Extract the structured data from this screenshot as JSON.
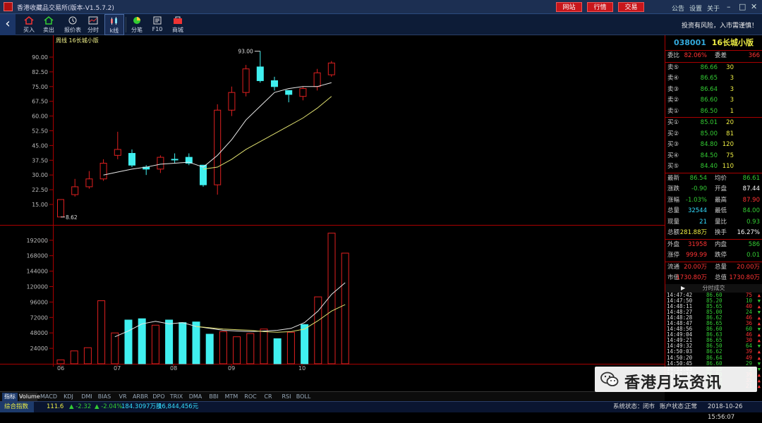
{
  "titlebar": {
    "title": "香港收藏品交易所(版本-V1.5.7.2)",
    "buttons": [
      "网站",
      "行情",
      "交易"
    ],
    "links": [
      "公告",
      "设置",
      "关于"
    ]
  },
  "toolbar": {
    "items": [
      {
        "label": "买入",
        "icon": "buy-icon"
      },
      {
        "label": "卖出",
        "icon": "sell-icon"
      },
      {
        "label": "报价表",
        "icon": "quote-table-icon"
      },
      {
        "label": "分时",
        "icon": "timeshare-icon"
      },
      {
        "label": "k线",
        "icon": "kline-icon"
      },
      {
        "label": "分笔",
        "icon": "tick-icon"
      },
      {
        "label": "F10",
        "icon": "f10-icon"
      },
      {
        "label": "商城",
        "icon": "mall-icon"
      }
    ],
    "risk": "投资有风险，入市需谨慎！"
  },
  "chart_data": {
    "type": "candlestick",
    "title": "周线  16长城小版",
    "yticks": [
      "90.00",
      "82.50",
      "75.00",
      "67.50",
      "60.00",
      "52.50",
      "45.00",
      "37.50",
      "30.00",
      "22.50",
      "15.00"
    ],
    "ylim": [
      8.62,
      93.0
    ],
    "annotations": {
      "high": "93.00",
      "low": "8.62"
    },
    "xticks": [
      "06",
      "07",
      "08",
      "09",
      "10"
    ],
    "candles": [
      {
        "o": 8.62,
        "c": 17.5,
        "h": 17.5,
        "l": 8.62,
        "up": true
      },
      {
        "o": 20,
        "c": 24,
        "h": 28,
        "l": 19,
        "up": true
      },
      {
        "o": 24,
        "c": 28,
        "h": 32,
        "l": 23,
        "up": true
      },
      {
        "o": 28,
        "c": 36,
        "h": 38,
        "l": 27,
        "up": true
      },
      {
        "o": 40,
        "c": 43,
        "h": 52,
        "l": 38,
        "up": true
      },
      {
        "o": 41,
        "c": 35,
        "h": 43,
        "l": 34,
        "up": false
      },
      {
        "o": 34,
        "c": 33,
        "h": 35,
        "l": 30,
        "up": false
      },
      {
        "o": 33,
        "c": 39,
        "h": 40,
        "l": 31,
        "up": true
      },
      {
        "o": 38,
        "c": 38,
        "h": 41,
        "l": 36,
        "up": false
      },
      {
        "o": 39,
        "c": 36,
        "h": 41,
        "l": 35,
        "up": false
      },
      {
        "o": 35,
        "c": 25,
        "h": 35,
        "l": 24,
        "up": false
      },
      {
        "o": 25,
        "c": 63,
        "h": 66,
        "l": 20,
        "up": true
      },
      {
        "o": 63,
        "c": 72,
        "h": 75,
        "l": 60,
        "up": true
      },
      {
        "o": 72,
        "c": 84,
        "h": 86,
        "l": 70,
        "up": true
      },
      {
        "o": 85,
        "c": 78,
        "h": 93,
        "l": 77,
        "up": false
      },
      {
        "o": 78,
        "c": 75,
        "h": 80,
        "l": 73,
        "up": false
      },
      {
        "o": 73,
        "c": 71,
        "h": 73,
        "l": 67,
        "up": false
      },
      {
        "o": 70,
        "c": 74,
        "h": 75,
        "l": 68,
        "up": true
      },
      {
        "o": 75,
        "c": 82,
        "h": 84,
        "l": 73,
        "up": true
      },
      {
        "o": 81,
        "c": 87,
        "h": 88,
        "l": 80,
        "up": true
      }
    ],
    "ma_short": [
      null,
      null,
      null,
      30,
      31.5,
      33,
      34,
      35.5,
      36,
      36.5,
      34,
      40,
      48,
      58,
      65,
      72,
      74,
      75,
      75,
      77
    ],
    "ma_long": [
      null,
      null,
      null,
      null,
      null,
      null,
      null,
      null,
      null,
      null,
      33,
      34,
      38,
      43,
      47,
      51,
      55,
      59,
      64,
      70
    ],
    "volume": {
      "yticks": [
        "192000",
        "168000",
        "144000",
        "120000",
        "96000",
        "72000",
        "48000",
        "24000"
      ],
      "values": [
        6000,
        20000,
        25000,
        98000,
        48000,
        68000,
        70000,
        60000,
        68000,
        64000,
        65000,
        46000,
        50000,
        42000,
        47000,
        54000,
        39000,
        49000,
        61000,
        104000,
        203000,
        172000
      ],
      "up": [
        true,
        true,
        true,
        true,
        true,
        false,
        false,
        true,
        false,
        false,
        false,
        false,
        true,
        true,
        true,
        true,
        false,
        true,
        false,
        true,
        true,
        true
      ],
      "ma1": [
        null,
        null,
        null,
        null,
        42000,
        51000,
        62000,
        66000,
        62000,
        64000,
        58000,
        55000,
        52000,
        51000,
        50000,
        51000,
        52000,
        55000,
        64000,
        82000,
        108000,
        126000
      ],
      "ma2": [
        null,
        null,
        null,
        null,
        null,
        null,
        null,
        null,
        null,
        null,
        58000,
        56000,
        54000,
        53000,
        52000,
        50000,
        49000,
        50000,
        54000,
        67000,
        82000,
        92000
      ]
    }
  },
  "stock": {
    "code": "038001",
    "name": "16长城小版"
  },
  "stats1": [
    {
      "l": "委比",
      "v": "82.06%",
      "vc": "red",
      "l2": "委差",
      "v2": "366",
      "v2c": "red"
    }
  ],
  "sells": [
    {
      "l": "卖⑤",
      "p": "86.66",
      "q": "30"
    },
    {
      "l": "卖④",
      "p": "86.65",
      "q": "3"
    },
    {
      "l": "卖③",
      "p": "86.64",
      "q": "3"
    },
    {
      "l": "卖②",
      "p": "86.60",
      "q": "3"
    },
    {
      "l": "卖①",
      "p": "86.50",
      "q": "1"
    }
  ],
  "buys": [
    {
      "l": "买①",
      "p": "85.01",
      "q": "20"
    },
    {
      "l": "买②",
      "p": "85.00",
      "q": "81"
    },
    {
      "l": "买③",
      "p": "84.80",
      "q": "120"
    },
    {
      "l": "买④",
      "p": "84.50",
      "q": "75"
    },
    {
      "l": "买⑤",
      "p": "84.40",
      "q": "110"
    }
  ],
  "stats2": [
    {
      "l": "最新",
      "v": "86.54",
      "vc": "green",
      "l2": "均价",
      "v2": "86.61",
      "v2c": "green"
    },
    {
      "l": "涨跌",
      "v": "-0.90",
      "vc": "green",
      "l2": "开盘",
      "v2": "87.44",
      "v2c": "white"
    },
    {
      "l": "涨幅",
      "v": "-1.03%",
      "vc": "green",
      "l2": "最高",
      "v2": "87.90",
      "v2c": "red"
    },
    {
      "l": "总量",
      "v": "32544",
      "vc": "cyan",
      "l2": "最低",
      "v2": "84.00",
      "v2c": "green"
    },
    {
      "l": "现量",
      "v": "21",
      "vc": "cyan",
      "l2": "量比",
      "v2": "0.93",
      "v2c": "green"
    },
    {
      "l": "总额",
      "v": "281.88万",
      "vc": "yel",
      "l2": "换手",
      "v2": "16.27%",
      "v2c": "white"
    }
  ],
  "stats3": [
    {
      "l": "外盘",
      "v": "31958",
      "vc": "red",
      "l2": "内盘",
      "v2": "586",
      "v2c": "green"
    },
    {
      "l": "涨停",
      "v": "999.99",
      "vc": "red",
      "l2": "跌停",
      "v2": "0.01",
      "v2c": "green"
    }
  ],
  "stats4": [
    {
      "l": "流通",
      "v": "20.00万",
      "vc": "red",
      "l2": "总量",
      "v2": "20.00万",
      "v2c": "red"
    },
    {
      "l": "市值",
      "v": "1730.80万",
      "vc": "red",
      "l2": "总值",
      "v2": "1730.80万",
      "v2c": "red"
    }
  ],
  "ticks_title": "分时成交",
  "ticks": [
    {
      "t": "14:47:42",
      "p": "86.60",
      "q": "75",
      "d": "up"
    },
    {
      "t": "14:47:50",
      "p": "85.20",
      "q": "10",
      "d": "down"
    },
    {
      "t": "14:48:11",
      "p": "85.65",
      "q": "40",
      "d": "up"
    },
    {
      "t": "14:48:27",
      "p": "85.00",
      "q": "24",
      "d": "down"
    },
    {
      "t": "14:48:28",
      "p": "86.62",
      "q": "46",
      "d": "up"
    },
    {
      "t": "14:48:47",
      "p": "86.65",
      "q": "36",
      "d": "up"
    },
    {
      "t": "14:48:56",
      "p": "86.60",
      "q": "60",
      "d": "down"
    },
    {
      "t": "14:49:04",
      "p": "86.63",
      "q": "46",
      "d": "up"
    },
    {
      "t": "14:49:21",
      "p": "86.65",
      "q": "30",
      "d": "up"
    },
    {
      "t": "14:49:32",
      "p": "86.50",
      "q": "64",
      "d": "down"
    },
    {
      "t": "14:50:03",
      "p": "86.62",
      "q": "39",
      "d": "up"
    },
    {
      "t": "14:50:20",
      "p": "86.64",
      "q": "49",
      "d": "up"
    },
    {
      "t": "14:50:45",
      "p": "86.60",
      "q": "29",
      "d": "down"
    },
    {
      "t": "14:51:03",
      "p": "86.55",
      "q": "5",
      "d": "down"
    },
    {
      "t": "14:51:12",
      "p": "86.50",
      "q": "39",
      "d": "up"
    },
    {
      "t": "14:51:19",
      "p": "86.53",
      "q": "35",
      "d": "up"
    },
    {
      "t": "14:51:54",
      "p": "86.54",
      "q": "21",
      "d": "up"
    }
  ],
  "tabs": [
    "指标",
    "Volume",
    "MACD",
    "KDJ",
    "DMI",
    "BIAS",
    "VR",
    "ARBR",
    "DPO",
    "TRIX",
    "DMA",
    "BBI",
    "MTM",
    "ROC",
    "CR",
    "RSI",
    "BOLL"
  ],
  "status": {
    "index_label": "综合指数",
    "index_value": "111.6",
    "change": "▲ -2.32",
    "pct": "▲ -2.04%",
    "volume": "184.3097万股",
    "amount": "16,844,456元",
    "sys_label": "系统状态：",
    "sys_value": "闭市",
    "acct_label": "账户状态：",
    "acct_value": "正常",
    "datetime": "2018-10-26 15:56:07"
  },
  "watermark": {
    "text": "香港月坛资讯"
  },
  "colors": {
    "up": "#e02020",
    "down": "#40f0f0",
    "ma1": "#e8e8e8",
    "ma2": "#e0e070",
    "bg": "#000000"
  }
}
